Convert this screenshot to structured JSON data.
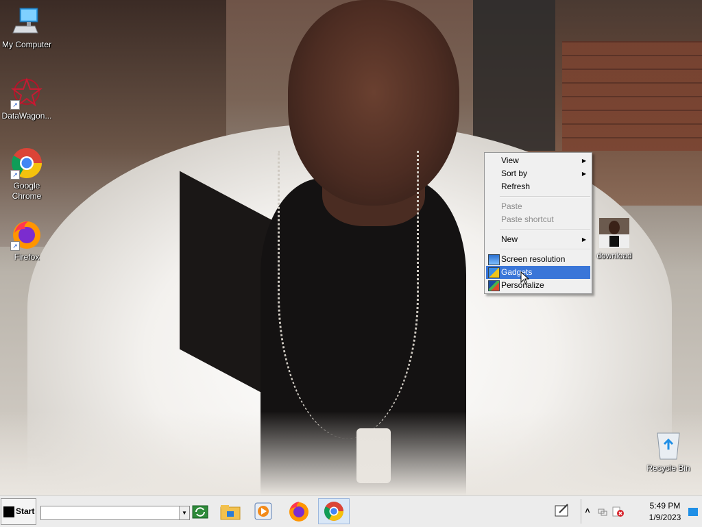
{
  "desktop": {
    "icons": [
      {
        "label": "My Computer",
        "icon": "computer-icon"
      },
      {
        "label": "DataWagon...",
        "icon": "datawagon-icon"
      },
      {
        "label": "Google Chrome",
        "icon": "chrome-icon"
      },
      {
        "label": "Firefox",
        "icon": "firefox-icon"
      },
      {
        "label": "download",
        "icon": "image-file-icon"
      },
      {
        "label": "Recycle Bin",
        "icon": "recycle-bin-icon"
      }
    ]
  },
  "context_menu": {
    "items": [
      {
        "label": "View",
        "submenu": true
      },
      {
        "label": "Sort by",
        "submenu": true
      },
      {
        "label": "Refresh"
      },
      {
        "label": "Paste",
        "disabled": true
      },
      {
        "label": "Paste shortcut",
        "disabled": true
      },
      {
        "label": "New",
        "submenu": true
      },
      {
        "label": "Screen resolution",
        "icon": "display-icon"
      },
      {
        "label": "Gadgets",
        "icon": "gadgets-icon",
        "highlighted": true
      },
      {
        "label": "Personalize",
        "icon": "personalize-icon"
      }
    ]
  },
  "taskbar": {
    "start_label": "Start",
    "address_value": "",
    "pinned": [
      "refresh-app-icon",
      "file-explorer-icon",
      "media-player-icon",
      "firefox-icon",
      "chrome-icon"
    ],
    "tray_icons": [
      "show-hidden-icon",
      "network-icon",
      "action-center-icon"
    ],
    "clock": {
      "time": "5:49 PM",
      "date": "1/9/2023"
    }
  },
  "colors": {
    "menu_highlight": "#3a76d8",
    "taskbar_bg": "#ececec"
  }
}
